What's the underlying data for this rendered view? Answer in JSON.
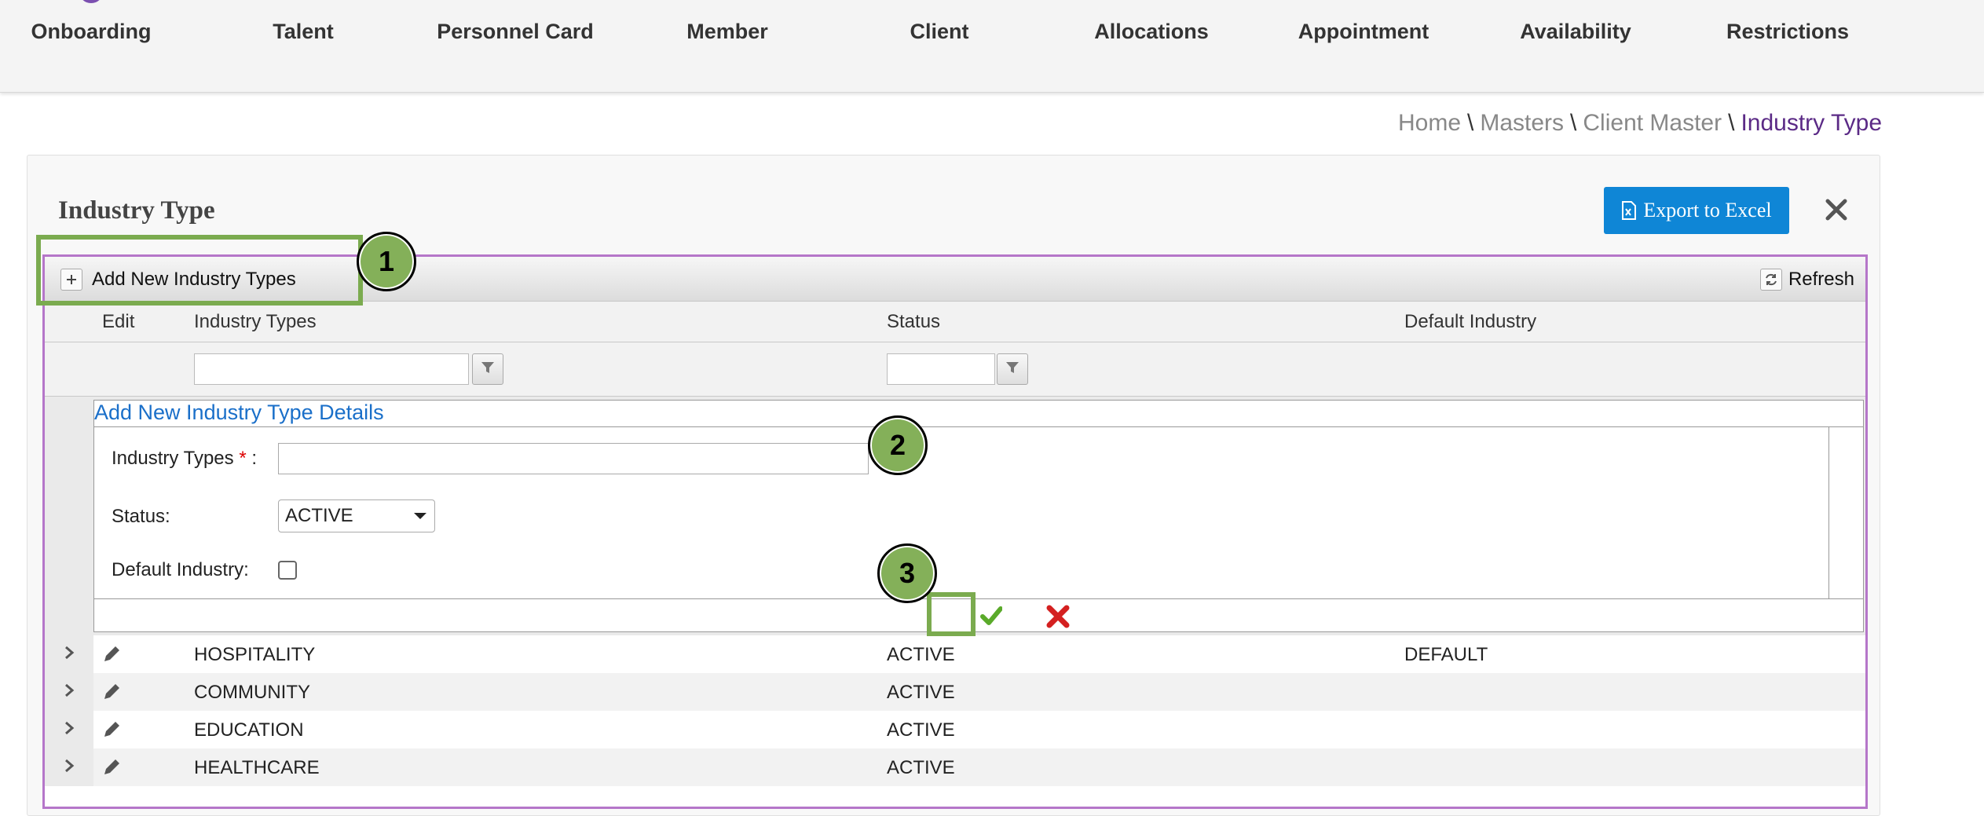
{
  "nav": {
    "items": [
      {
        "label": "Onboarding",
        "icon": "onboarding-icon"
      },
      {
        "label": "Talent",
        "icon": "talent-icon"
      },
      {
        "label": "Personnel Card",
        "icon": "personnel-card-icon"
      },
      {
        "label": "Member",
        "icon": "member-icon"
      },
      {
        "label": "Client",
        "icon": "client-icon"
      },
      {
        "label": "Allocations",
        "icon": "allocations-icon"
      },
      {
        "label": "Appointment",
        "icon": "appointment-icon"
      },
      {
        "label": "Availability",
        "icon": "availability-icon"
      },
      {
        "label": "Restrictions",
        "icon": "restrictions-icon"
      }
    ]
  },
  "breadcrumb": {
    "home": "Home",
    "masters": "Masters",
    "client_master": "Client Master",
    "current": "Industry Type",
    "separator": "\\"
  },
  "panel": {
    "title": "Industry Type",
    "export_label": "Export to Excel"
  },
  "grid": {
    "toolbar": {
      "add_label": "Add New Industry Types",
      "refresh_label": "Refresh"
    },
    "columns": {
      "edit": "Edit",
      "industry_types": "Industry Types",
      "status": "Status",
      "default_industry": "Default Industry"
    },
    "filters": {
      "industry_types_value": "",
      "status_value": ""
    },
    "form": {
      "title": "Add New Industry Type Details",
      "industry_label": "Industry Types",
      "required_mark": "*",
      "colon": ":",
      "industry_value": "",
      "status_label": "Status:",
      "status_value": "ACTIVE",
      "default_label": "Default Industry:",
      "default_checked": false
    },
    "rows": [
      {
        "industry": "HOSPITALITY",
        "status": "ACTIVE",
        "default": "DEFAULT"
      },
      {
        "industry": "COMMUNITY",
        "status": "ACTIVE",
        "default": ""
      },
      {
        "industry": "EDUCATION",
        "status": "ACTIVE",
        "default": ""
      },
      {
        "industry": "HEALTHCARE",
        "status": "ACTIVE",
        "default": ""
      }
    ]
  },
  "annotations": {
    "step1": "1",
    "step2": "2",
    "step3": "3"
  },
  "colors": {
    "accent_purple": "#5b2a86",
    "grid_border": "#b576c9",
    "export_blue": "#0f86d6",
    "link_blue": "#1a6fc9",
    "annotation_green": "#84b059",
    "confirm_green": "#5aaa2a",
    "cancel_red": "#d42020"
  }
}
